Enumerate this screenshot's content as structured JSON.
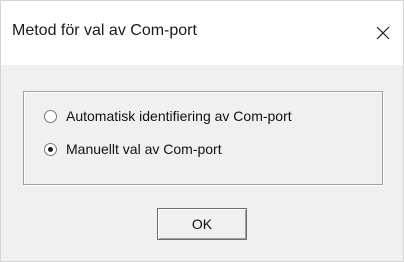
{
  "window": {
    "title": "Metod för val av Com-port"
  },
  "options": [
    {
      "label": "Automatisk identifiering av Com-port",
      "selected": false
    },
    {
      "label": "Manuellt val av Com-port",
      "selected": true
    }
  ],
  "buttons": {
    "ok_label": "OK"
  },
  "icons": {
    "close": "close-icon"
  }
}
